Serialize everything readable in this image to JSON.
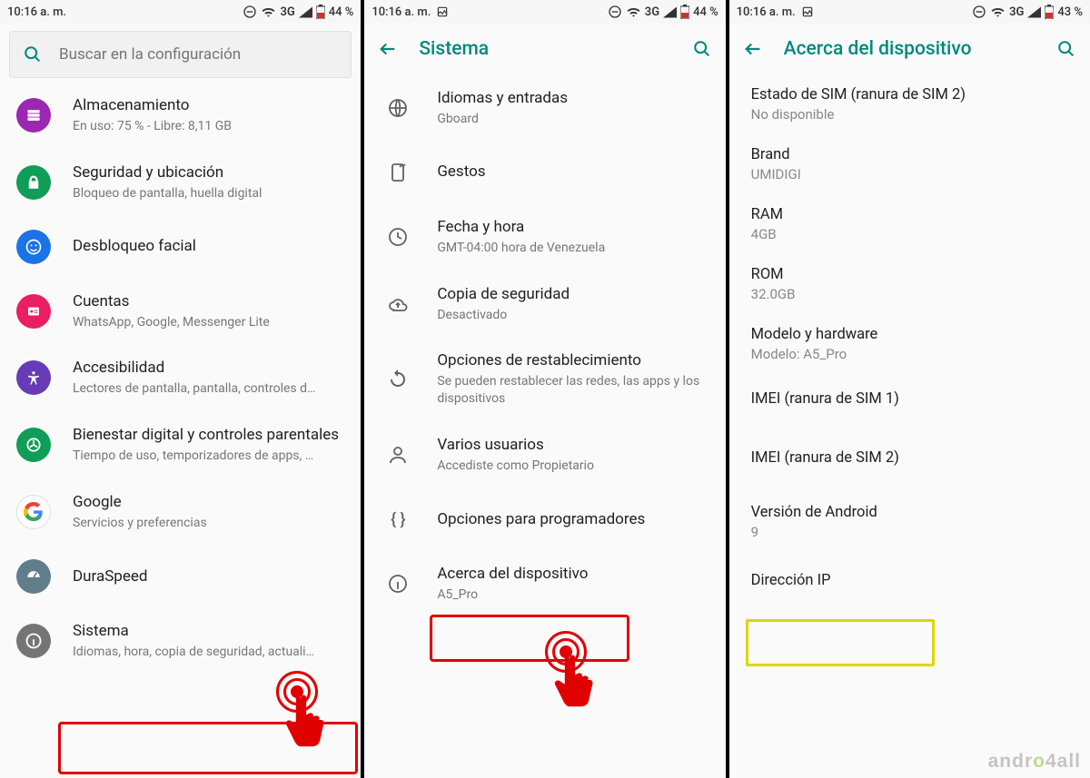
{
  "statusbar": {
    "time1": "10:16 a. m.",
    "time2": "10:16 a. m.",
    "time3": "10:16 a. m.",
    "net": "3G",
    "batt1": "44 %",
    "batt2": "44 %",
    "batt3": "43 %"
  },
  "screen1": {
    "search_placeholder": "Buscar en la configuración",
    "items": [
      {
        "title": "Almacenamiento",
        "sub": "En uso: 75 % - Libre: 8,11 GB"
      },
      {
        "title": "Seguridad y ubicación",
        "sub": "Bloqueo de pantalla, huella digital"
      },
      {
        "title": "Desbloqueo facial",
        "sub": ""
      },
      {
        "title": "Cuentas",
        "sub": "WhatsApp, Google, Messenger Lite"
      },
      {
        "title": "Accesibilidad",
        "sub": "Lectores de pantalla, pantalla, controles d…"
      },
      {
        "title": "Bienestar digital y controles parentales",
        "sub": "Tiempo de uso, temporizadores de apps, …"
      },
      {
        "title": "Google",
        "sub": "Servicios y preferencias"
      },
      {
        "title": "DuraSpeed",
        "sub": ""
      },
      {
        "title": "Sistema",
        "sub": "Idiomas, hora, copia de seguridad, actuali…"
      }
    ]
  },
  "screen2": {
    "header": "Sistema",
    "items": [
      {
        "title": "Idiomas y entradas",
        "sub": "Gboard"
      },
      {
        "title": "Gestos",
        "sub": ""
      },
      {
        "title": "Fecha y hora",
        "sub": "GMT-04:00 hora de Venezuela"
      },
      {
        "title": "Copia de seguridad",
        "sub": "Desactivado"
      },
      {
        "title": "Opciones de restablecimiento",
        "sub": "Se pueden restablecer las redes, las apps y los dispositivos"
      },
      {
        "title": "Varios usuarios",
        "sub": "Accediste como Propietario"
      },
      {
        "title": "Opciones para programadores",
        "sub": ""
      },
      {
        "title": "Acerca del dispositivo",
        "sub": "A5_Pro"
      }
    ]
  },
  "screen3": {
    "header": "Acerca del dispositivo",
    "items": [
      {
        "title": "Estado de SIM (ranura de SIM 2)",
        "sub": "No disponible"
      },
      {
        "title": "Brand",
        "sub": "UMIDIGI"
      },
      {
        "title": "RAM",
        "sub": "4GB"
      },
      {
        "title": "ROM",
        "sub": "32.0GB"
      },
      {
        "title": "Modelo y hardware",
        "sub": "Modelo: A5_Pro"
      },
      {
        "title": "IMEI (ranura de SIM 1)",
        "sub": ""
      },
      {
        "title": "IMEI (ranura de SIM 2)",
        "sub": ""
      },
      {
        "title": "Versión de Android",
        "sub": "9"
      },
      {
        "title": "Dirección IP",
        "sub": ""
      }
    ]
  },
  "watermark_a": "andr",
  "watermark_b": "4all"
}
